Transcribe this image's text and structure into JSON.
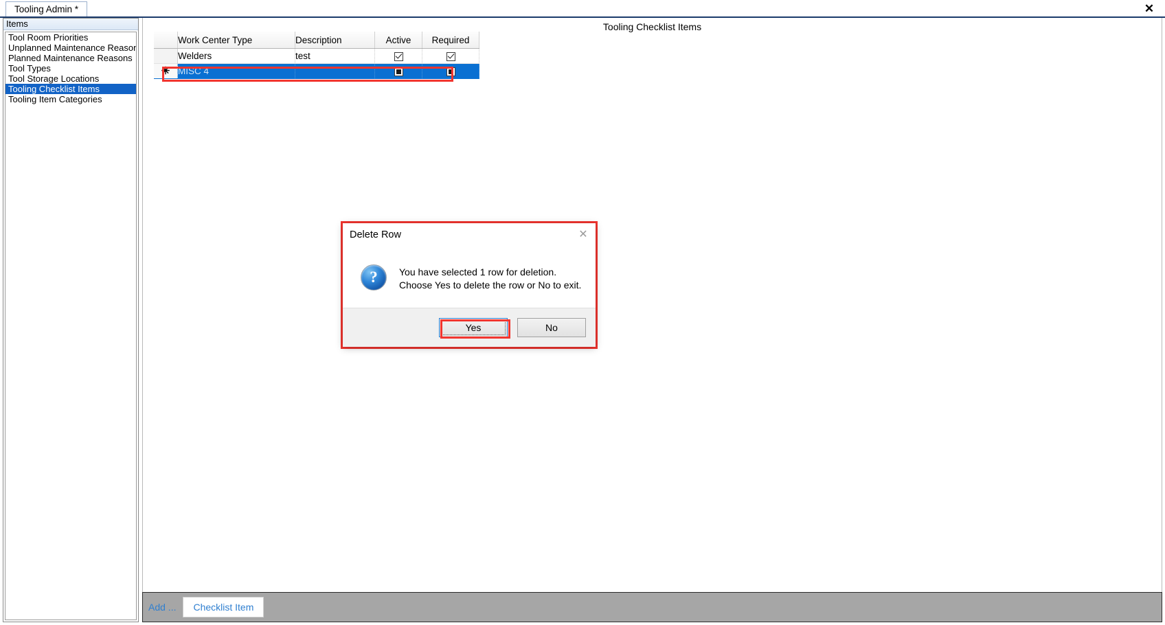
{
  "window": {
    "tab_label": "Tooling Admin *",
    "close_icon": "close-icon",
    "close_glyph": "✕"
  },
  "sidebar": {
    "header": "Items",
    "items": [
      {
        "label": "Tool Room Priorities",
        "selected": false
      },
      {
        "label": "Unplanned Maintenance Reasons",
        "selected": false
      },
      {
        "label": "Planned Maintenance Reasons",
        "selected": false
      },
      {
        "label": "Tool Types",
        "selected": false
      },
      {
        "label": "Tool Storage Locations",
        "selected": false
      },
      {
        "label": "Tooling Checklist Items",
        "selected": true
      },
      {
        "label": "Tooling Item Categories",
        "selected": false
      }
    ]
  },
  "main": {
    "title": "Tooling Checklist Items",
    "grid": {
      "columns": [
        "Work Center Type",
        "Description",
        "Active",
        "Required"
      ],
      "rows": [
        {
          "marker": "",
          "work_center_type": "Welders",
          "description": "test",
          "active": "checked",
          "required": "checked",
          "selected": false
        },
        {
          "marker": "✳",
          "work_center_type": "MISC 4",
          "description": "",
          "active": "filled",
          "required": "filled",
          "selected": true
        }
      ]
    }
  },
  "bottom_bar": {
    "add_label": "Add ...",
    "checklist_item_button": "Checklist Item"
  },
  "dialog": {
    "title": "Delete Row",
    "close_glyph": "✕",
    "icon": "question-icon",
    "icon_glyph": "?",
    "message_line1": "You have selected 1 row for deletion.",
    "message_line2": "Choose Yes to delete the row or No to exit.",
    "yes_button": "Yes",
    "no_button": "No"
  },
  "colors": {
    "selection_blue": "#0a70d2",
    "highlight_red": "#f2352f",
    "link_blue": "#2f7fd0",
    "toolbar_gray": "#a6a6a6"
  }
}
